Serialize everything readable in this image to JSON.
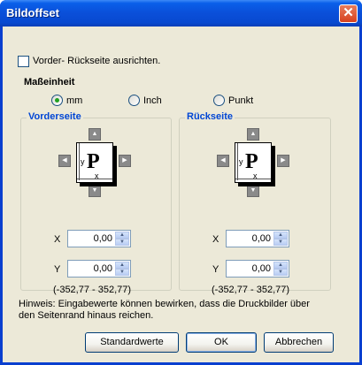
{
  "window": {
    "title": "Bildoffset",
    "close_glyph": "✕"
  },
  "align": {
    "label": "Vorder- Rückseite ausrichten.",
    "checked": false
  },
  "unit": {
    "heading": "Maßeinheit",
    "options": [
      {
        "label": "mm",
        "checked": true
      },
      {
        "label": "Inch",
        "checked": false
      },
      {
        "label": "Punkt",
        "checked": false
      }
    ]
  },
  "front": {
    "title": "Vorderseite",
    "letter": "P",
    "x_label": "X",
    "y_label": "Y",
    "x_value": "0,00",
    "y_value": "0,00",
    "range": "(-352,77 - 352,77)"
  },
  "back": {
    "title": "Rückseite",
    "letter": "P",
    "x_label": "X",
    "y_label": "Y",
    "x_value": "0,00",
    "y_value": "0,00",
    "range": "(-352,77 - 352,77)"
  },
  "axis": {
    "x": "x",
    "y": "y"
  },
  "arrows": {
    "up": "▲",
    "down": "▼",
    "left": "◀",
    "right": "▶"
  },
  "hint": "Hinweis: Eingabewerte können bewirken, dass die Druckbilder über den Seitenrand hinaus reichen.",
  "buttons": {
    "standard": "Standardwerte",
    "ok": "OK",
    "cancel": "Abbrechen"
  }
}
